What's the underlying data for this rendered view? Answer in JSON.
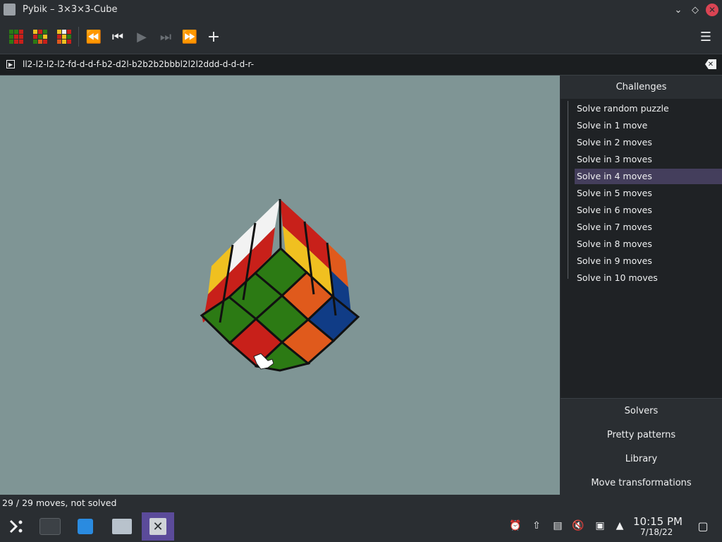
{
  "window": {
    "title": "Pybik – 3×3×3-Cube",
    "close_glyph": "✕",
    "minimize_glyph": "⌵",
    "maximize_glyph": "◇"
  },
  "toolbar": {
    "buttons": [
      {
        "name": "new-solved-cube-icon"
      },
      {
        "name": "new-random-cube-icon"
      },
      {
        "name": "reset-rotation-icon"
      },
      {
        "name": "rewind-button",
        "glyph": "⏪"
      },
      {
        "name": "previous-button",
        "glyph": "⏮"
      },
      {
        "name": "play-button",
        "glyph": "▶"
      },
      {
        "name": "next-button",
        "glyph": "⏭"
      },
      {
        "name": "forward-button",
        "glyph": "⏩"
      },
      {
        "name": "add-mark-button",
        "glyph": "+"
      },
      {
        "name": "hamburger-menu",
        "glyph": "☰"
      }
    ]
  },
  "moves": {
    "text": "ll2-l2-l2-l2-fd-d-d-f-b2-d2l-b2b2b2bbbl2l2l2ddd-d-d-d-r-"
  },
  "sidebar": {
    "header": "Challenges",
    "items": [
      "Solve random puzzle",
      "Solve in 1 move",
      "Solve in 2 moves",
      "Solve in 3 moves",
      "Solve in 4 moves",
      "Solve in 5 moves",
      "Solve in 6 moves",
      "Solve in 7 moves",
      "Solve in 8 moves",
      "Solve in 9 moves",
      "Solve in 10 moves"
    ],
    "selected_index": 4,
    "sections": [
      "Solvers",
      "Pretty patterns",
      "Library",
      "Move transformations"
    ]
  },
  "status": {
    "text": "29 / 29 moves, not solved"
  },
  "taskbar": {
    "clock_time": "10:15 PM",
    "clock_date": "7/18/22"
  },
  "colors": {
    "canvas": "#7f9595",
    "selection": "#443e5c",
    "cube_red": "#c8201a",
    "cube_green": "#2c7a14",
    "cube_orange": "#e05a1c",
    "cube_blue": "#103c86",
    "cube_yellow": "#f0c020",
    "cube_white": "#f2f2f2"
  }
}
